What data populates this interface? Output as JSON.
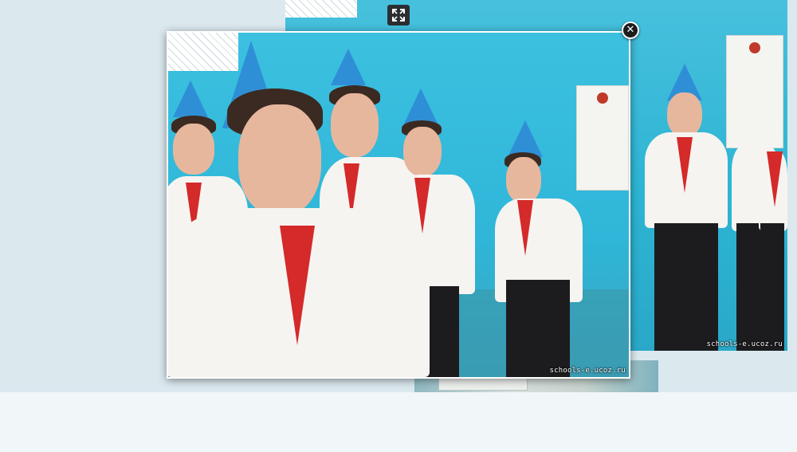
{
  "lightbox": {
    "watermark": "schools-e.ucoz.ru",
    "close_icon": "close-icon",
    "close_glyph": "✕",
    "fullscreen_icon": "expand-icon"
  },
  "background_photo": {
    "watermark": "schools-e.ucoz.ru"
  },
  "colors": {
    "page_background": "#dbe9ef",
    "footer_background": "#f1f6f8",
    "cap_blue": "#2f8fd6",
    "tie_red": "#d42a2a",
    "wall_cyan": "#2fb6d8"
  }
}
